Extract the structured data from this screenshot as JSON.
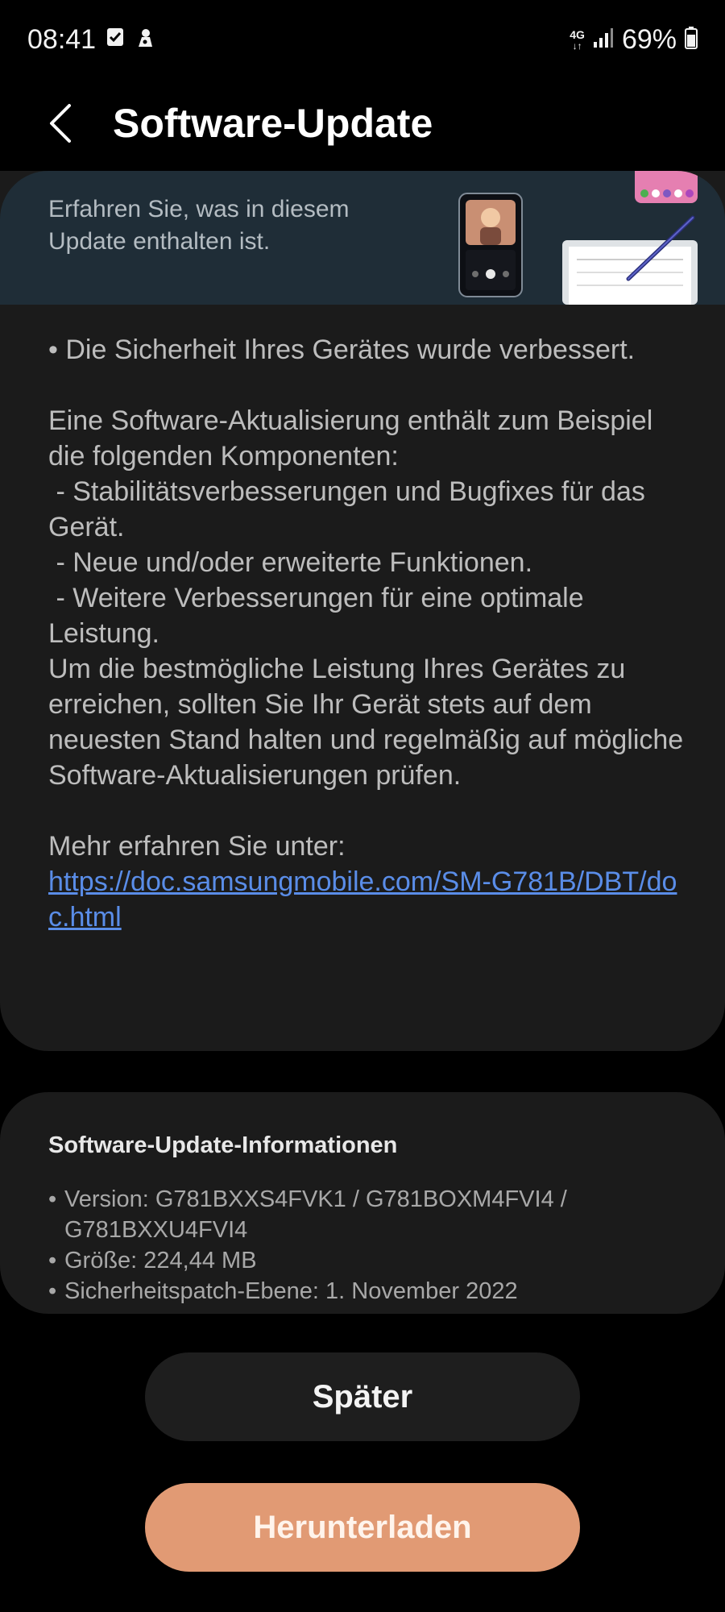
{
  "status_bar": {
    "time": "08:41",
    "network": "4G",
    "battery_percent": "69%"
  },
  "header": {
    "title": "Software-Update",
    "back_icon": "chevron-left-icon"
  },
  "banner": {
    "text": "Erfahren Sie, was in diesem Update enthalten ist."
  },
  "notes": {
    "security_line": "• Die Sicherheit Ihres Gerätes wurde verbessert.",
    "components_intro": "Eine Software-Aktualisierung enthält zum Beispiel die folgenden Komponenten:",
    "component_1": " - Stabilitätsverbesserungen und Bugfixes für das Gerät.",
    "component_2": " - Neue und/oder erweiterte Funktionen.",
    "component_3": " - Weitere Verbesserungen für eine optimale Leistung.",
    "recommendation": "Um die bestmögliche Leistung Ihres Gerätes zu erreichen, sollten Sie Ihr Gerät stets auf dem neuesten Stand halten und regelmäßig auf mögliche Software-Aktualisierungen prüfen.",
    "more_info_label": "Mehr erfahren Sie unter:",
    "link": "https://doc.samsungmobile.com/SM-G781B/DBT/doc.html"
  },
  "info": {
    "title": "Software-Update-Informationen",
    "version": "Version: G781BXXS4FVK1 / G781BOXM4FVI4 / G781BXXU4FVI4",
    "size": "Größe: 224,44 MB",
    "security_patch": "Sicherheitspatch-Ebene: 1. November 2022"
  },
  "buttons": {
    "later": "Später",
    "download": "Herunterladen"
  },
  "colors": {
    "background": "#000000",
    "card": "#1b1b1b",
    "banner": "#1f2d37",
    "link": "#5a8de8",
    "download_button": "#e19a74"
  }
}
